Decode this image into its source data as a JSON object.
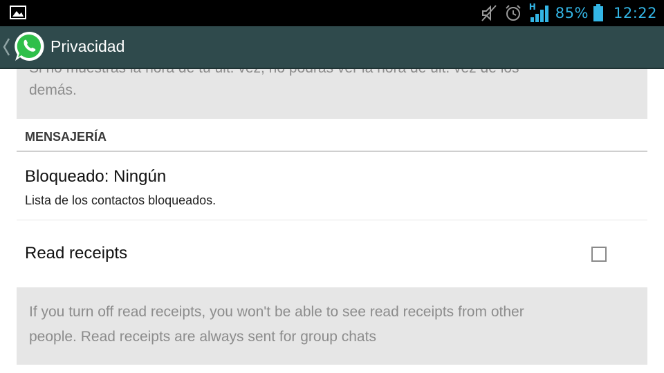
{
  "status_bar": {
    "network_type": "H",
    "battery_percent": "85%",
    "time": "12:22",
    "icons": [
      "image-notification-icon",
      "mute-icon",
      "alarm-icon",
      "signal-icon",
      "battery-icon"
    ],
    "accent_color": "#33b5e5"
  },
  "action_bar": {
    "title": "Privacidad",
    "background_color": "#2f4a4c"
  },
  "last_seen_note": {
    "line1": "Si no muestras la hora de tu últ. vez, no podrás ver la hora de últ. vez de los",
    "line2": "demás."
  },
  "messaging_section": {
    "header": "MENSAJERÍA",
    "blocked": {
      "title": "Bloqueado: Ningún",
      "summary": "Lista de los contactos bloqueados."
    },
    "read_receipts": {
      "title": "Read receipts",
      "checked": false
    }
  },
  "read_receipts_note": {
    "line1": "If you turn off read receipts, you won't be able to see read receipts from other",
    "line2": "people. Read receipts are always sent for group chats"
  }
}
